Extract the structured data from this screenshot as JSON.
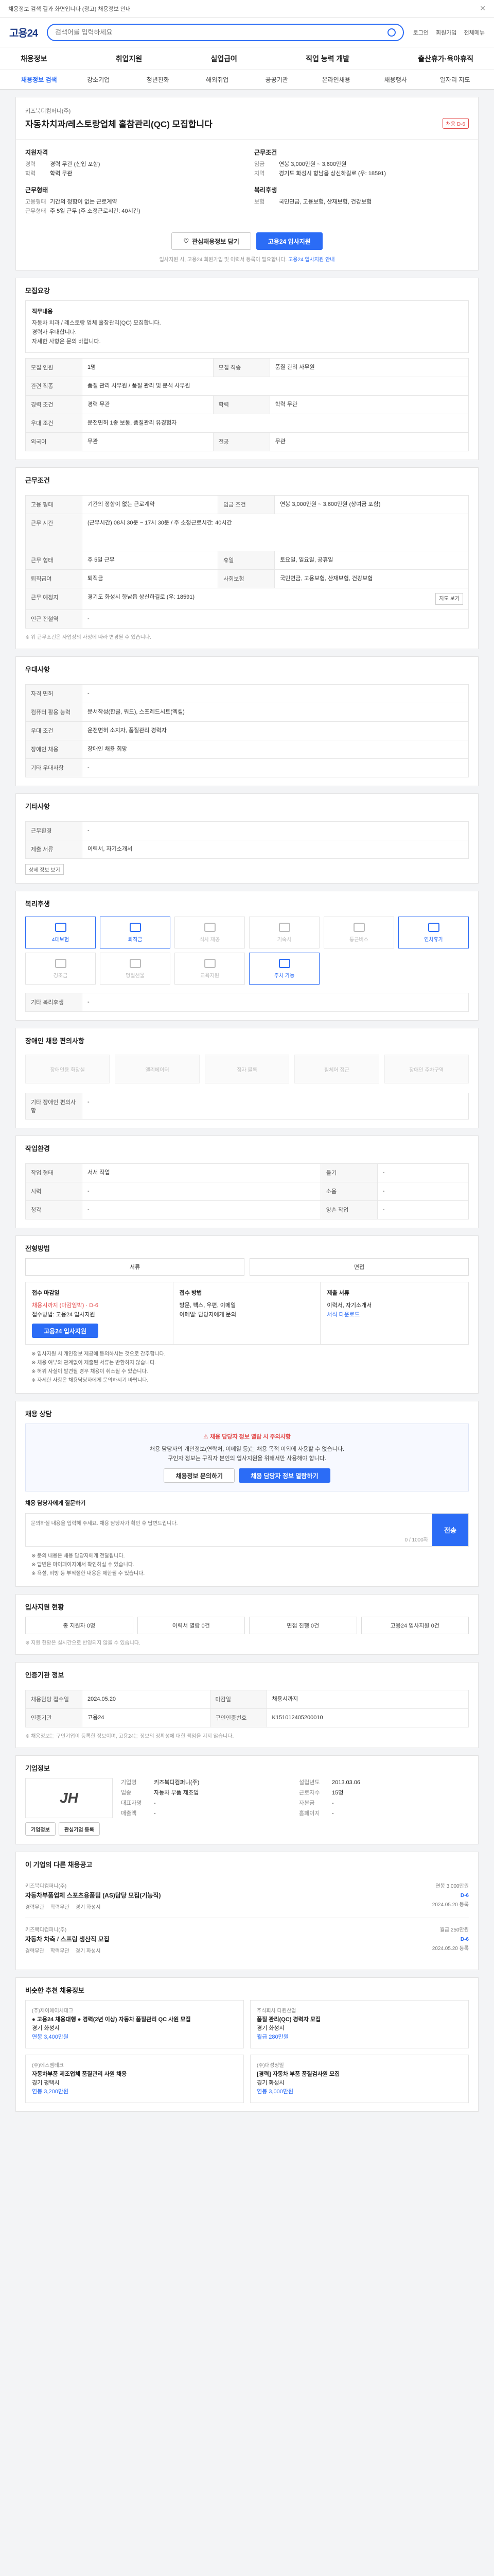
{
  "topbar": {
    "text": "채용정보 검색 결과 화면입니다 (광고) 채용정보 안내"
  },
  "header": {
    "logo": "고용24",
    "search_placeholder": "검색어를 입력하세요",
    "links": [
      "로그인",
      "회원가입",
      "전체메뉴"
    ]
  },
  "gnb": [
    "채용정보",
    "취업지원",
    "실업급여",
    "직업 능력 개발",
    "출산휴가·육아휴직"
  ],
  "subnav": [
    "채용정보 검색",
    "강소기업",
    "청년친화",
    "해외취업",
    "공공기관",
    "온라인채용",
    "채용행사",
    "일자리 지도"
  ],
  "job": {
    "company": "키즈북디컴퍼니(주)",
    "title": "자동차치과/레스토랑업체 홀참관리(QC) 모집합니다",
    "badge": "채용 D-6",
    "summary_left_title": "지원자격",
    "summary_left": [
      {
        "k": "경력",
        "v": "경력 무관 (신입 포함)"
      },
      {
        "k": "학력",
        "v": "학력 무관"
      }
    ],
    "summary_left2_title": "근무형태",
    "summary_left2": [
      {
        "k": "고용형태",
        "v": "기간의 정함이 없는 근로계약"
      },
      {
        "k": "근무형태",
        "v": "주 5일 근무 (주 소정근로시간: 40시간)"
      }
    ],
    "summary_right_title": "근무조건",
    "summary_right": [
      {
        "k": "임금",
        "v": "연봉 3,000만원 ~ 3,600만원"
      },
      {
        "k": "지역",
        "v": "경기도 화성시 향남읍 상신하길로 (우: 18591)"
      }
    ],
    "summary_right2_title": "복리후생",
    "summary_right2": [
      {
        "k": "보험",
        "v": "국민연금, 고용보험, 산재보험, 건강보험"
      }
    ]
  },
  "actions": {
    "scrap": "관심채용정보 담기",
    "apply": "고용24 입사지원",
    "note_prefix": "입사지원 시, 고용24 회원가입 및 이력서 등록이 필요합니다.",
    "note_link": "고용24 입사지원 안내"
  },
  "desc": {
    "title": "모집요강",
    "head": "직무내용",
    "lines": [
      "자동차 치과 / 레스토랑 업체 홀참관리(QC) 모집합니다.",
      "경력자 우대합니다.",
      "자세한 사항은 문의 바랍니다."
    ],
    "table": [
      {
        "k": "모집 인원",
        "v": "1명"
      },
      {
        "k": "모집 직종",
        "v": "품질 관리 사무원"
      },
      {
        "k": "관련 직종",
        "v": "품질 관리 사무원 / 품질 관리 및 분석 사무원"
      },
      {
        "k": "경력 조건",
        "v": "경력 무관"
      },
      {
        "k": "학력",
        "v": "학력 무관"
      },
      {
        "k": "우대 조건",
        "v": "운전면허 1종 보통, 품질관리 유경험자"
      },
      {
        "k": "외국어",
        "v": "무관"
      },
      {
        "k": "전공",
        "v": "무관"
      }
    ]
  },
  "conditions": {
    "title": "근무조건",
    "table": [
      {
        "k": "고용 형태",
        "v": "기간의 정함이 없는 근로계약"
      },
      {
        "k": "임금 조건",
        "v": "연봉 3,000만원 ~ 3,600만원 (상여금 포함)"
      },
      {
        "k": "근무 시간",
        "v": "(근무시간) 08시 30분 ~ 17시 30분 / 주 소정근로시간: 40시간"
      },
      {
        "k": "근무 형태",
        "v": "주 5일 근무"
      },
      {
        "k": "휴일",
        "v": "토요일, 일요일, 공휴일"
      },
      {
        "k": "퇴직급여",
        "v": "퇴직금"
      },
      {
        "k": "사회보험",
        "v": "국민연금, 고용보험, 산재보험, 건강보험"
      },
      {
        "k": "근무 예정지",
        "v": "경기도 화성시 향남읍 상신하길로 (우: 18591)"
      },
      {
        "k": "인근 전철역",
        "v": "-"
      }
    ],
    "map_button": "지도 보기",
    "foot": "※ 위 근무조건은 사업장의 사정에 따라 변경될 수 있습니다."
  },
  "workplace": {
    "title": "우대사항",
    "table": [
      {
        "k": "자격 면허",
        "v": "-"
      },
      {
        "k": "컴퓨터 활용 능력",
        "v": "문서작성(한글, 워드), 스프레드시트(엑셀)"
      },
      {
        "k": "우대 조건",
        "v": "운전면허 소지자, 품질관리 경력자"
      },
      {
        "k": "장애인 채용",
        "v": "장애인 채용 희망"
      },
      {
        "k": "기타 우대사항",
        "v": "-"
      }
    ]
  },
  "extra": {
    "title": "기타사항",
    "table": [
      {
        "k": "근무환경",
        "v": "-"
      },
      {
        "k": "제출 서류",
        "v": "이력서, 자기소개서"
      }
    ],
    "more": "상세 정보 보기"
  },
  "welfare": {
    "title": "복리후생",
    "items": [
      {
        "label": "4대보험",
        "on": true
      },
      {
        "label": "퇴직금",
        "on": true
      },
      {
        "label": "식사 제공",
        "on": false
      },
      {
        "label": "기숙사",
        "on": false
      },
      {
        "label": "통근버스",
        "on": false
      },
      {
        "label": "연차휴가",
        "on": true
      },
      {
        "label": "경조금",
        "on": false
      },
      {
        "label": "명절선물",
        "on": false
      },
      {
        "label": "교육지원",
        "on": false
      },
      {
        "label": "주차 가능",
        "on": true
      }
    ],
    "etc_label": "기타 복리후생",
    "etc": "-"
  },
  "accessibility": {
    "title": "장애인 채용 편의사항",
    "items": [
      "장애인용 화장실",
      "엘리베이터",
      "점자 블록",
      "휠체어 접근",
      "장애인 주차구역"
    ],
    "etc_label": "기타 장애인 편의사항",
    "etc": "-"
  },
  "env": {
    "title": "작업환경",
    "table": [
      {
        "k": "작업 형태",
        "v": "서서 작업",
        "k2": "들기",
        "v2": "-"
      },
      {
        "k": "시력",
        "v": "-",
        "k2": "소음",
        "v2": "-"
      },
      {
        "k": "청각",
        "v": "-",
        "k2": "양손 작업",
        "v2": "-"
      }
    ]
  },
  "apply_method": {
    "title": "전형방법",
    "steps": [
      "서류",
      "면접"
    ],
    "box1_title": "접수 마감일",
    "box1_lines": [
      "채용시까지 (마감임박) · D-6",
      "접수방법: 고용24 입사지원"
    ],
    "box1_button": "고용24 입사지원",
    "box2_title": "접수 방법",
    "box2_lines": [
      "방문, 팩스, 우편, 이메일",
      "이메일: 담당자에게 문의"
    ],
    "box3_title": "제출 서류",
    "box3_lines": [
      "이력서, 자기소개서"
    ],
    "box3_link": "서식 다운로드",
    "bullets": [
      "※ 입사지원 시 개인정보 제공에 동의하시는 것으로 간주합니다.",
      "※ 채용 여부와 관계없이 제출된 서류는 반환하지 않습니다.",
      "※ 허위 사실이 발견될 경우 채용이 취소될 수 있습니다.",
      "※ 자세한 사항은 채용담당자에게 문의하시기 바랍니다."
    ]
  },
  "safety": {
    "title": "채용 상담",
    "warn_title": "채용 담당자 정보 열람 시 주의사항",
    "warn_lines": [
      "채용 담당자의 개인정보(연락처, 이메일 등)는 채용 목적 이외에 사용할 수 없습니다.",
      "구인자 정보는 구직자 본인의 입사지원을 위해서만 사용해야 합니다."
    ],
    "btn1": "채용정보 문의하기",
    "btn2": "채용 담당자 정보 열람하기",
    "qa_label": "채용 담당자에게 질문하기",
    "qa_placeholder": "문의하실 내용을 입력해 주세요. 채용 담당자가 확인 후 답변드립니다.",
    "qa_counter": "0 / 1000자",
    "qa_send": "전송",
    "qa_notes": [
      "※ 문의 내용은 채용 담당자에게 전달됩니다.",
      "※ 답변은 마이페이지에서 확인하실 수 있습니다.",
      "※ 욕설, 비방 등 부적절한 내용은 제한될 수 있습니다."
    ]
  },
  "process": {
    "title": "입사지원 현황",
    "tags": [
      "총 지원자 0명",
      "이력서 열람 0건",
      "면접 진행 0건",
      "고용24 입사지원 0건"
    ],
    "note": "※ 지원 현황은 실시간으로 반영되지 않을 수 있습니다."
  },
  "manager": {
    "title": "인증기관 정보",
    "table": [
      {
        "k": "채용담당 접수일",
        "v": "2024.05.20",
        "k2": "마감일",
        "v2": "채용시까지"
      },
      {
        "k": "인증기관",
        "v": "고용24",
        "k2": "구인인증번호",
        "v2": "K151012405200010"
      }
    ],
    "foot": "※ 채용정보는 구인기업이 등록한 정보이며, 고용24는 정보의 정확성에 대한 책임을 지지 않습니다."
  },
  "company": {
    "title": "기업정보",
    "logo_text": "JH",
    "buttons": [
      "기업정보",
      "관심기업 등록"
    ],
    "info": [
      {
        "k": "기업명",
        "v": "키즈북디컴퍼니(주)"
      },
      {
        "k": "설립년도",
        "v": "2013.03.06"
      },
      {
        "k": "업종",
        "v": "자동차 부품 제조업"
      },
      {
        "k": "근로자수",
        "v": "15명"
      },
      {
        "k": "대표자명",
        "v": "-"
      },
      {
        "k": "자본금",
        "v": "-"
      },
      {
        "k": "매출액",
        "v": "-"
      },
      {
        "k": "홈페이지",
        "v": "-"
      }
    ]
  },
  "similar": {
    "title": "이 기업의 다른 채용공고",
    "items": [
      {
        "co": "키즈북디컴퍼니(주)",
        "title": "자동차부품업체 스포츠용품팀 (AS)담당 모집(기능직)",
        "meta": [
          "경력무관",
          "학력무관",
          "경기 화성시"
        ],
        "right": [
          "연봉 3,000만원",
          "D-6",
          "2024.05.20 등록"
        ]
      },
      {
        "co": "키즈북디컴퍼니(주)",
        "title": "자동차 차축 / 스프링 생산직 모집",
        "meta": [
          "경력무관",
          "학력무관",
          "경기 화성시"
        ],
        "right": [
          "월급 250만원",
          "D-6",
          "2024.05.20 등록"
        ]
      }
    ]
  },
  "reco": {
    "title": "비슷한 추천 채용정보",
    "items": [
      {
        "co": "(주)제이에이치테크",
        "title": "● 고용24 채용대행 ● 경력(2년 이상) 자동차 품질관리 QC 사원 모집",
        "lines": [
          "경기 화성시",
          "연봉 3,400만원"
        ]
      },
      {
        "co": "주식회사 다원산업",
        "title": "품질 관리(QC) 경력자 모집",
        "lines": [
          "경기 화성시",
          "월급 280만원"
        ]
      },
      {
        "co": "(주)에스엠테크",
        "title": "자동차부품 제조업체 품질관리 사원 채용",
        "lines": [
          "경기 평택시",
          "연봉 3,200만원"
        ]
      },
      {
        "co": "(주)대성정밀",
        "title": "[경력] 자동차 부품 품질검사원 모집",
        "lines": [
          "경기 화성시",
          "연봉 3,000만원"
        ]
      }
    ]
  }
}
